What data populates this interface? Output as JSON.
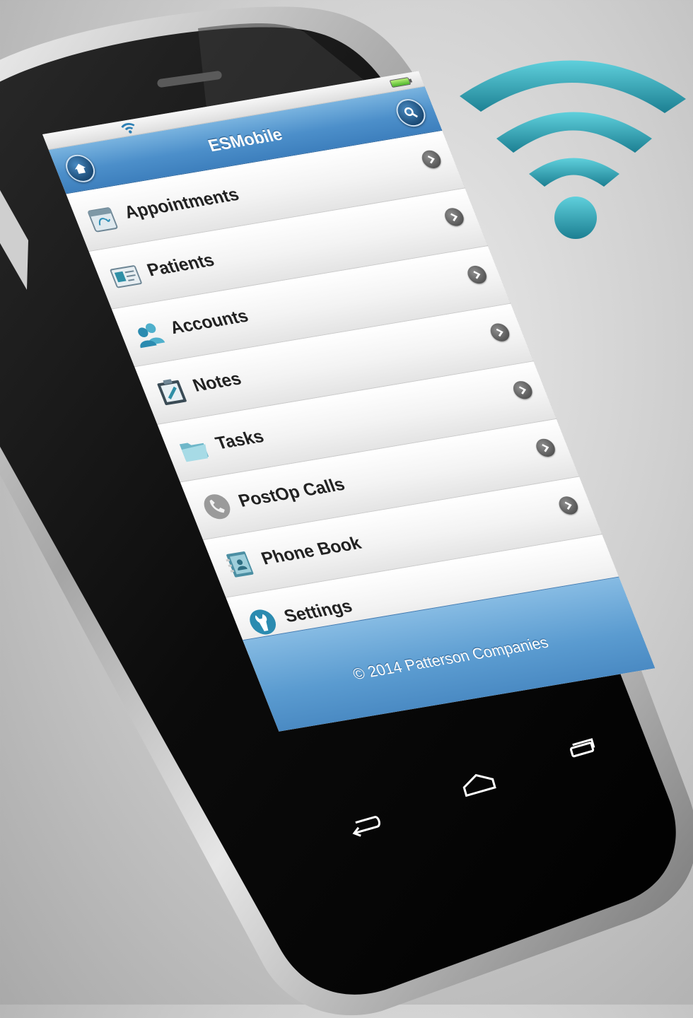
{
  "app": {
    "title": "ESMobile",
    "home_button": "home-icon",
    "search_button": "search-icon"
  },
  "status_bar": {
    "wifi_icon": "wifi-icon",
    "battery_icon": "battery-icon"
  },
  "menu": {
    "items": [
      {
        "label": "Appointments",
        "icon": "calendar-icon"
      },
      {
        "label": "Patients",
        "icon": "id-card-icon"
      },
      {
        "label": "Accounts",
        "icon": "users-icon"
      },
      {
        "label": "Notes",
        "icon": "clipboard-icon"
      },
      {
        "label": "Tasks",
        "icon": "folder-icon"
      },
      {
        "label": "PostOp Calls",
        "icon": "phone-icon"
      },
      {
        "label": "Phone Book",
        "icon": "address-book-icon"
      },
      {
        "label": "Settings",
        "icon": "wrench-icon"
      }
    ]
  },
  "footer": {
    "copyright": "© 2014 Patterson Companies"
  },
  "android_keys": {
    "back": "back-icon",
    "home": "android-home-icon",
    "recent": "recent-apps-icon"
  },
  "colors": {
    "header_blue": "#4c8fca",
    "wifi_teal": "#2fa6b5"
  }
}
